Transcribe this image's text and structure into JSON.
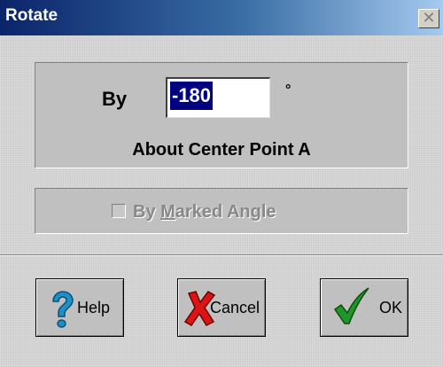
{
  "window": {
    "title": "Rotate",
    "close_glyph": "✕"
  },
  "rotate": {
    "by_label": "By",
    "angle_value": "-180",
    "degree_symbol": "°",
    "about_label": "About Center Point A"
  },
  "options": {
    "by_marked_angle_label": "By Marked Angle",
    "by_marked_angle_checked": false,
    "by_marked_angle_enabled": false
  },
  "buttons": {
    "help_label": "Help",
    "cancel_label": "Cancel",
    "ok_label": "OK"
  },
  "icons": {
    "help": "question-mark-icon",
    "cancel": "red-x-icon",
    "ok": "green-checkmark-icon"
  },
  "colors": {
    "titlebar_start": "#0a246a",
    "titlebar_end": "#a6caf0",
    "selection": "#000080",
    "help_icon": "#1e90c8",
    "cancel_icon": "#dc1414",
    "ok_icon": "#1e9628"
  }
}
